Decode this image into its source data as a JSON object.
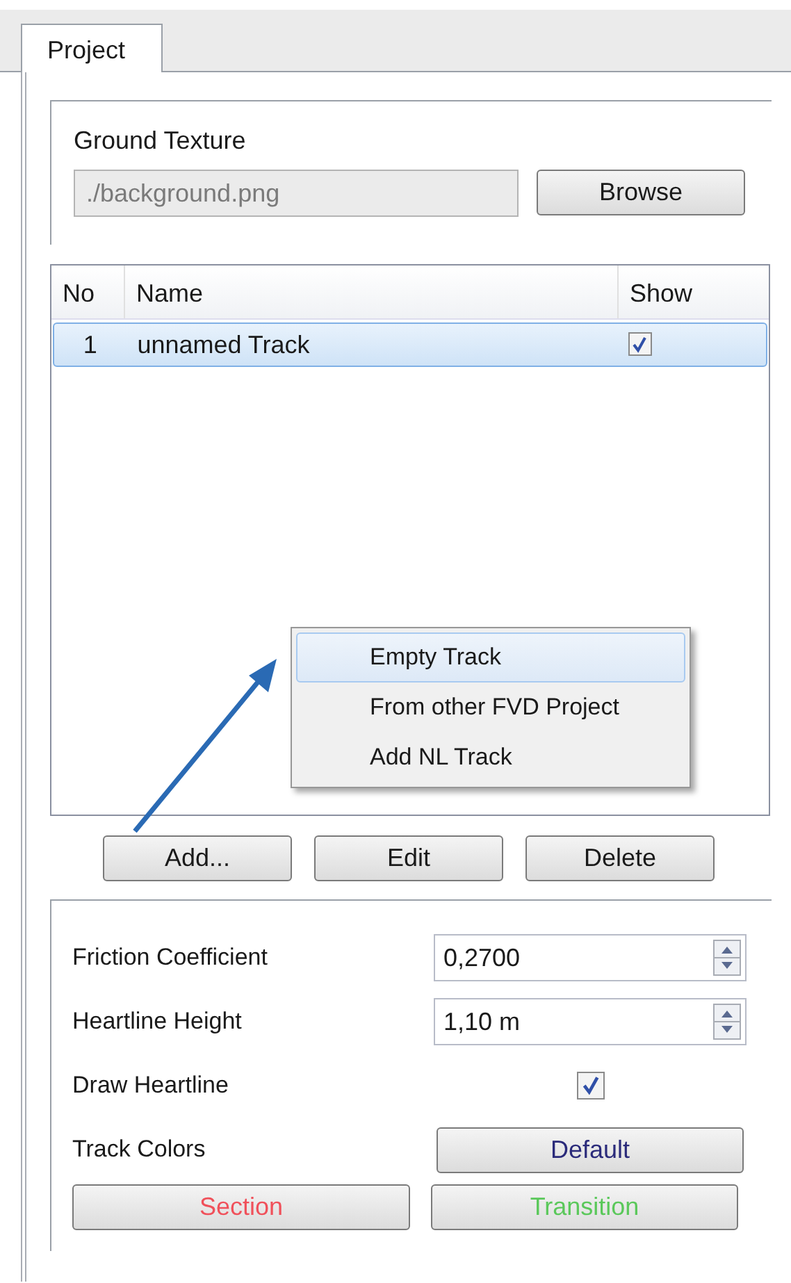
{
  "tabs": [
    {
      "label": "Project",
      "selected": true
    }
  ],
  "ground_texture": {
    "label": "Ground Texture",
    "value": "./background.png",
    "disabled": true,
    "button": "Browse"
  },
  "table": {
    "columns": [
      "No",
      "Name",
      "Show"
    ],
    "rows": [
      {
        "no": "1",
        "name": "unnamed Track",
        "show": true,
        "selected": true
      }
    ]
  },
  "context_menu": {
    "items": [
      {
        "label": "Empty Track",
        "selected": true
      },
      {
        "label": "From other FVD Project",
        "selected": false
      },
      {
        "label": "Add NL Track",
        "selected": false
      }
    ]
  },
  "track_buttons": [
    "Add...",
    "Edit",
    "Delete"
  ],
  "settings": [
    {
      "kind": "spin",
      "label": "Friction Coefficient",
      "value": "0,2700"
    },
    {
      "kind": "spin",
      "label": "Heartline Height",
      "value": "1,10 m"
    },
    {
      "kind": "check",
      "label": "Draw Heartline",
      "checked": true
    },
    {
      "kind": "button",
      "label": "Track Colors",
      "button": "Default"
    }
  ],
  "color_buttons": [
    {
      "label": "Section",
      "color": "#f0505a"
    },
    {
      "label": "Transition",
      "color": "#5ac85a"
    }
  ]
}
